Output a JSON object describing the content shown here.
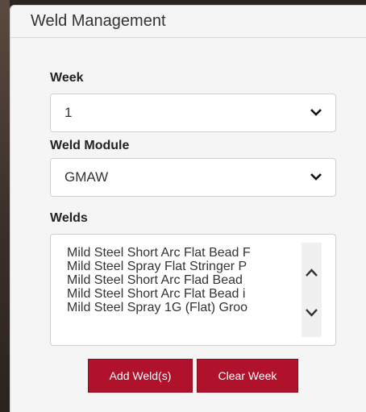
{
  "panel": {
    "title": "Weld Management"
  },
  "week": {
    "label": "Week",
    "selected": "1"
  },
  "module": {
    "label": "Weld Module",
    "selected": "GMAW"
  },
  "welds": {
    "label": "Welds",
    "items": [
      "Mild Steel Short Arc Flat Bead F",
      "Mild Steel Spray Flat Stringer P",
      "Mild Steel Short Arc Flad Bead",
      "Mild Steel Short Arc Flat Bead i",
      "Mild Steel Spray 1G (Flat) Groo"
    ]
  },
  "buttons": {
    "add": "Add Weld(s)",
    "clear": "Clear Week"
  },
  "colors": {
    "button_bg": "#b0122b",
    "panel_bg": "#f5f5f5"
  }
}
